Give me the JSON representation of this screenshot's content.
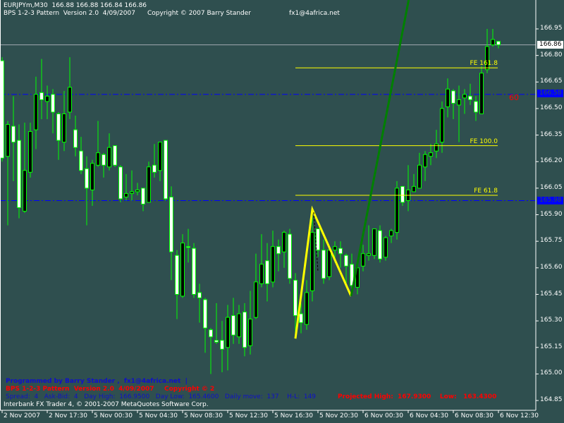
{
  "header": {
    "symbol_line": "EURJPYm,M30  166.88 166.88 166.84 166.86",
    "indicator_name": "BPS 1-2-3 Pattern  Version 2.0  4/09/2007",
    "copyright": "Copyright © 2007 Barry Stander",
    "email": "fx1@4africa.net"
  },
  "footer": {
    "programmed_by": "Programmed by Barry Stander ,  fx1@4africa.net  |",
    "red_version": "BPS 1-2-3 Pattern  Version 2.0  4/09/2007",
    "red_copyright": "Copyright © 2",
    "stats": "Spread:  4   Ask-Bid:  4   Day High:  166.9500   Day Low:  165.4600   Daily move:  137    H-L:  149",
    "projected": "Projected High:  167.9300    Low:   163.4300",
    "platform": "Interbank FX Trader 4, © 2001-2007 MetaQuotes Software Corp."
  },
  "pattern_label": "60",
  "colors": {
    "background": "#2f4f4f",
    "candle_outline": "#00ff00",
    "bull_fill": "#000000",
    "bear_fill": "#ffffff",
    "fib_line": "#ffff00",
    "zigzag": "#ffff00",
    "projection": "#008000",
    "level_line": "#0000ff",
    "label_red": "#ff0000"
  },
  "price_axis": {
    "labels": [
      "166.95",
      "166.80",
      "166.65",
      "166.50",
      "166.35",
      "166.20",
      "166.05",
      "165.90",
      "165.75",
      "165.60",
      "165.45",
      "165.30",
      "165.15",
      "165.00",
      "164.85"
    ],
    "current_price": "166.86",
    "level_high": "166.58",
    "level_low": "165.98"
  },
  "time_axis": {
    "labels": [
      "2 Nov 2007",
      "2 Nov 17:30",
      "5 Nov 00:30",
      "5 Nov 04:30",
      "5 Nov 08:30",
      "5 Nov 12:30",
      "5 Nov 16:30",
      "5 Nov 20:30",
      "6 Nov 00:30",
      "6 Nov 04:30",
      "6 Nov 08:30",
      "6 Nov 12:30"
    ]
  },
  "fib_levels": [
    {
      "label": "FE 161.8",
      "price": 166.73
    },
    {
      "label": "FE 100.0",
      "price": 166.29
    },
    {
      "label": "FE 61.8",
      "price": 166.01
    }
  ],
  "chart_data": {
    "type": "candlestick",
    "symbol": "EURJPYm",
    "timeframe": "M30",
    "ylim": [
      164.8,
      167.0
    ],
    "horizontal_levels": [
      166.86,
      166.58,
      165.98
    ],
    "zigzag": [
      165.2,
      165.93,
      165.44
    ],
    "projection_line": [
      165.44,
      167.12
    ],
    "candles": [
      [
        166.77,
        166.79,
        166.2,
        166.22
      ],
      [
        166.23,
        166.43,
        165.84,
        166.41
      ],
      [
        166.4,
        166.57,
        166.09,
        166.31
      ],
      [
        166.32,
        166.41,
        165.88,
        165.94
      ],
      [
        165.92,
        166.42,
        165.91,
        166.15
      ],
      [
        166.14,
        166.42,
        166.11,
        166.37
      ],
      [
        166.38,
        166.68,
        166.27,
        166.58
      ],
      [
        166.59,
        166.78,
        166.44,
        166.55
      ],
      [
        166.54,
        166.63,
        166.44,
        166.57
      ],
      [
        166.58,
        166.61,
        166.36,
        166.48
      ],
      [
        166.47,
        166.48,
        166.21,
        166.32
      ],
      [
        166.31,
        166.6,
        166.26,
        166.47
      ],
      [
        166.48,
        166.79,
        166.44,
        166.62
      ],
      [
        166.38,
        166.46,
        166.23,
        166.28
      ],
      [
        166.26,
        166.34,
        166.13,
        166.15
      ],
      [
        166.16,
        166.23,
        165.84,
        166.05
      ],
      [
        166.04,
        166.21,
        165.95,
        166.19
      ],
      [
        166.18,
        166.43,
        166.17,
        166.25
      ],
      [
        166.24,
        166.25,
        166.11,
        166.18
      ],
      [
        166.17,
        166.36,
        166.15,
        166.28
      ],
      [
        166.29,
        166.29,
        166.17,
        166.18
      ],
      [
        166.17,
        166.18,
        165.97,
        165.99
      ],
      [
        166.0,
        166.13,
        165.98,
        166.02
      ],
      [
        166.02,
        166.15,
        165.98,
        166.03
      ],
      [
        166.03,
        166.08,
        166.01,
        166.04
      ],
      [
        166.05,
        166.05,
        165.92,
        165.96
      ],
      [
        165.97,
        166.2,
        165.97,
        166.17
      ],
      [
        166.18,
        166.3,
        166.11,
        166.14
      ],
      [
        166.15,
        166.31,
        166.09,
        166.31
      ],
      [
        166.32,
        166.32,
        165.98,
        165.99
      ],
      [
        166.0,
        166.06,
        165.53,
        165.69
      ],
      [
        165.67,
        165.7,
        165.31,
        165.45
      ],
      [
        165.44,
        165.79,
        165.43,
        165.74
      ],
      [
        165.72,
        165.82,
        165.63,
        165.715
      ],
      [
        165.71,
        165.74,
        165.43,
        165.45
      ],
      [
        165.46,
        165.51,
        165.29,
        165.43
      ],
      [
        165.42,
        165.43,
        165.12,
        165.26
      ],
      [
        165.25,
        165.26,
        165.0,
        165.21
      ],
      [
        165.19,
        165.4,
        165.17,
        165.18
      ],
      [
        165.19,
        165.3,
        165.01,
        165.14
      ],
      [
        165.15,
        165.39,
        165.02,
        165.32
      ],
      [
        165.33,
        165.43,
        165.17,
        165.22
      ],
      [
        165.21,
        165.39,
        165.17,
        165.34
      ],
      [
        165.35,
        165.4,
        165.1,
        165.15
      ],
      [
        165.16,
        165.47,
        165.11,
        165.31
      ],
      [
        165.32,
        165.68,
        165.31,
        165.52
      ],
      [
        165.51,
        165.79,
        165.49,
        165.62
      ],
      [
        165.64,
        165.74,
        165.41,
        165.51
      ],
      [
        165.52,
        165.81,
        165.49,
        165.72
      ],
      [
        165.72,
        165.76,
        165.58,
        165.68
      ],
      [
        165.69,
        165.81,
        165.6,
        165.8
      ],
      [
        165.79,
        165.82,
        165.51,
        165.54
      ],
      [
        165.53,
        165.57,
        165.23,
        165.33
      ],
      [
        165.34,
        165.4,
        165.23,
        165.29
      ],
      [
        165.28,
        165.53,
        165.25,
        165.46
      ],
      [
        165.47,
        165.9,
        165.41,
        165.8
      ],
      [
        165.82,
        165.82,
        165.66,
        165.7
      ],
      [
        165.7,
        165.76,
        165.51,
        165.54
      ],
      [
        165.55,
        165.7,
        165.53,
        165.7
      ],
      [
        165.7,
        165.75,
        165.63,
        165.72
      ],
      [
        165.71,
        165.75,
        165.6,
        165.68
      ],
      [
        165.67,
        165.68,
        165.49,
        165.61
      ],
      [
        165.62,
        165.68,
        165.45,
        165.5
      ],
      [
        165.49,
        165.65,
        165.45,
        165.6
      ],
      [
        165.61,
        165.73,
        165.58,
        165.68
      ],
      [
        165.67,
        165.84,
        165.64,
        165.68
      ],
      [
        165.67,
        165.82,
        165.65,
        165.82
      ],
      [
        165.81,
        165.84,
        165.63,
        165.65
      ],
      [
        165.66,
        165.78,
        165.64,
        165.77
      ],
      [
        165.78,
        165.82,
        165.74,
        165.81
      ],
      [
        165.8,
        166.09,
        165.76,
        166.05
      ],
      [
        166.06,
        166.06,
        165.95,
        165.97
      ],
      [
        165.98,
        166.18,
        165.92,
        166.04
      ],
      [
        166.03,
        166.13,
        166.03,
        166.06
      ],
      [
        166.05,
        166.25,
        166.05,
        166.18
      ],
      [
        166.17,
        166.26,
        166.09,
        166.24
      ],
      [
        166.23,
        166.3,
        166.18,
        166.25
      ],
      [
        166.26,
        166.38,
        166.22,
        166.3
      ],
      [
        166.31,
        166.54,
        166.25,
        166.5
      ],
      [
        166.51,
        166.67,
        166.45,
        166.61
      ],
      [
        166.6,
        166.61,
        166.44,
        166.53
      ],
      [
        166.52,
        166.63,
        166.31,
        166.55
      ],
      [
        166.56,
        166.61,
        166.47,
        166.58
      ],
      [
        166.57,
        166.64,
        166.52,
        166.55
      ],
      [
        166.54,
        166.57,
        166.43,
        166.48
      ],
      [
        166.47,
        166.74,
        166.47,
        166.7
      ],
      [
        166.72,
        166.95,
        166.7,
        166.85
      ],
      [
        166.86,
        166.95,
        166.85,
        166.89
      ],
      [
        166.88,
        166.88,
        166.84,
        166.86
      ]
    ]
  }
}
